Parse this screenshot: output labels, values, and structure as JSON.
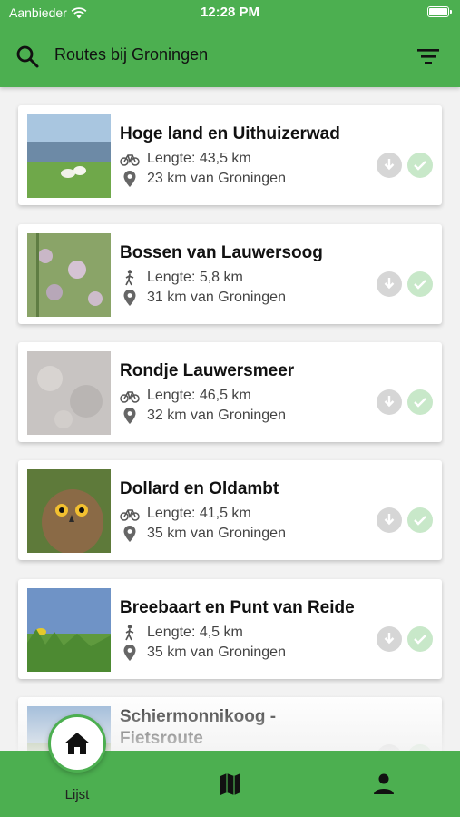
{
  "status_bar": {
    "carrier": "Aanbieder",
    "time": "12:28 PM"
  },
  "header": {
    "search_title": "Routes bij Groningen"
  },
  "routes": [
    {
      "title": "Hoge land en Uithuizerwad",
      "mode": "bike",
      "length": "Lengte: 43,5 km",
      "distance": "23 km van Groningen"
    },
    {
      "title": "Bossen van Lauwersoog",
      "mode": "walk",
      "length": "Lengte: 5,8 km",
      "distance": "31 km van Groningen"
    },
    {
      "title": "Rondje Lauwersmeer",
      "mode": "bike",
      "length": "Lengte: 46,5 km",
      "distance": "32 km van Groningen"
    },
    {
      "title": "Dollard en Oldambt",
      "mode": "bike",
      "length": "Lengte: 41,5 km",
      "distance": "35 km van Groningen"
    },
    {
      "title": "Breebaart en Punt van Reide",
      "mode": "walk",
      "length": "Lengte: 4,5 km",
      "distance": "35 km van Groningen"
    },
    {
      "title": "Schiermonnikoog - Fietsroute",
      "mode": "bike",
      "length": "",
      "distance": ""
    }
  ],
  "bottom_nav": {
    "home_label": "Lijst",
    "icons": [
      "home-icon",
      "map-icon",
      "user-icon"
    ]
  },
  "colors": {
    "primary": "#4caf50",
    "download_bg": "#d6d6d6",
    "check_bg": "#c8e8c9"
  }
}
